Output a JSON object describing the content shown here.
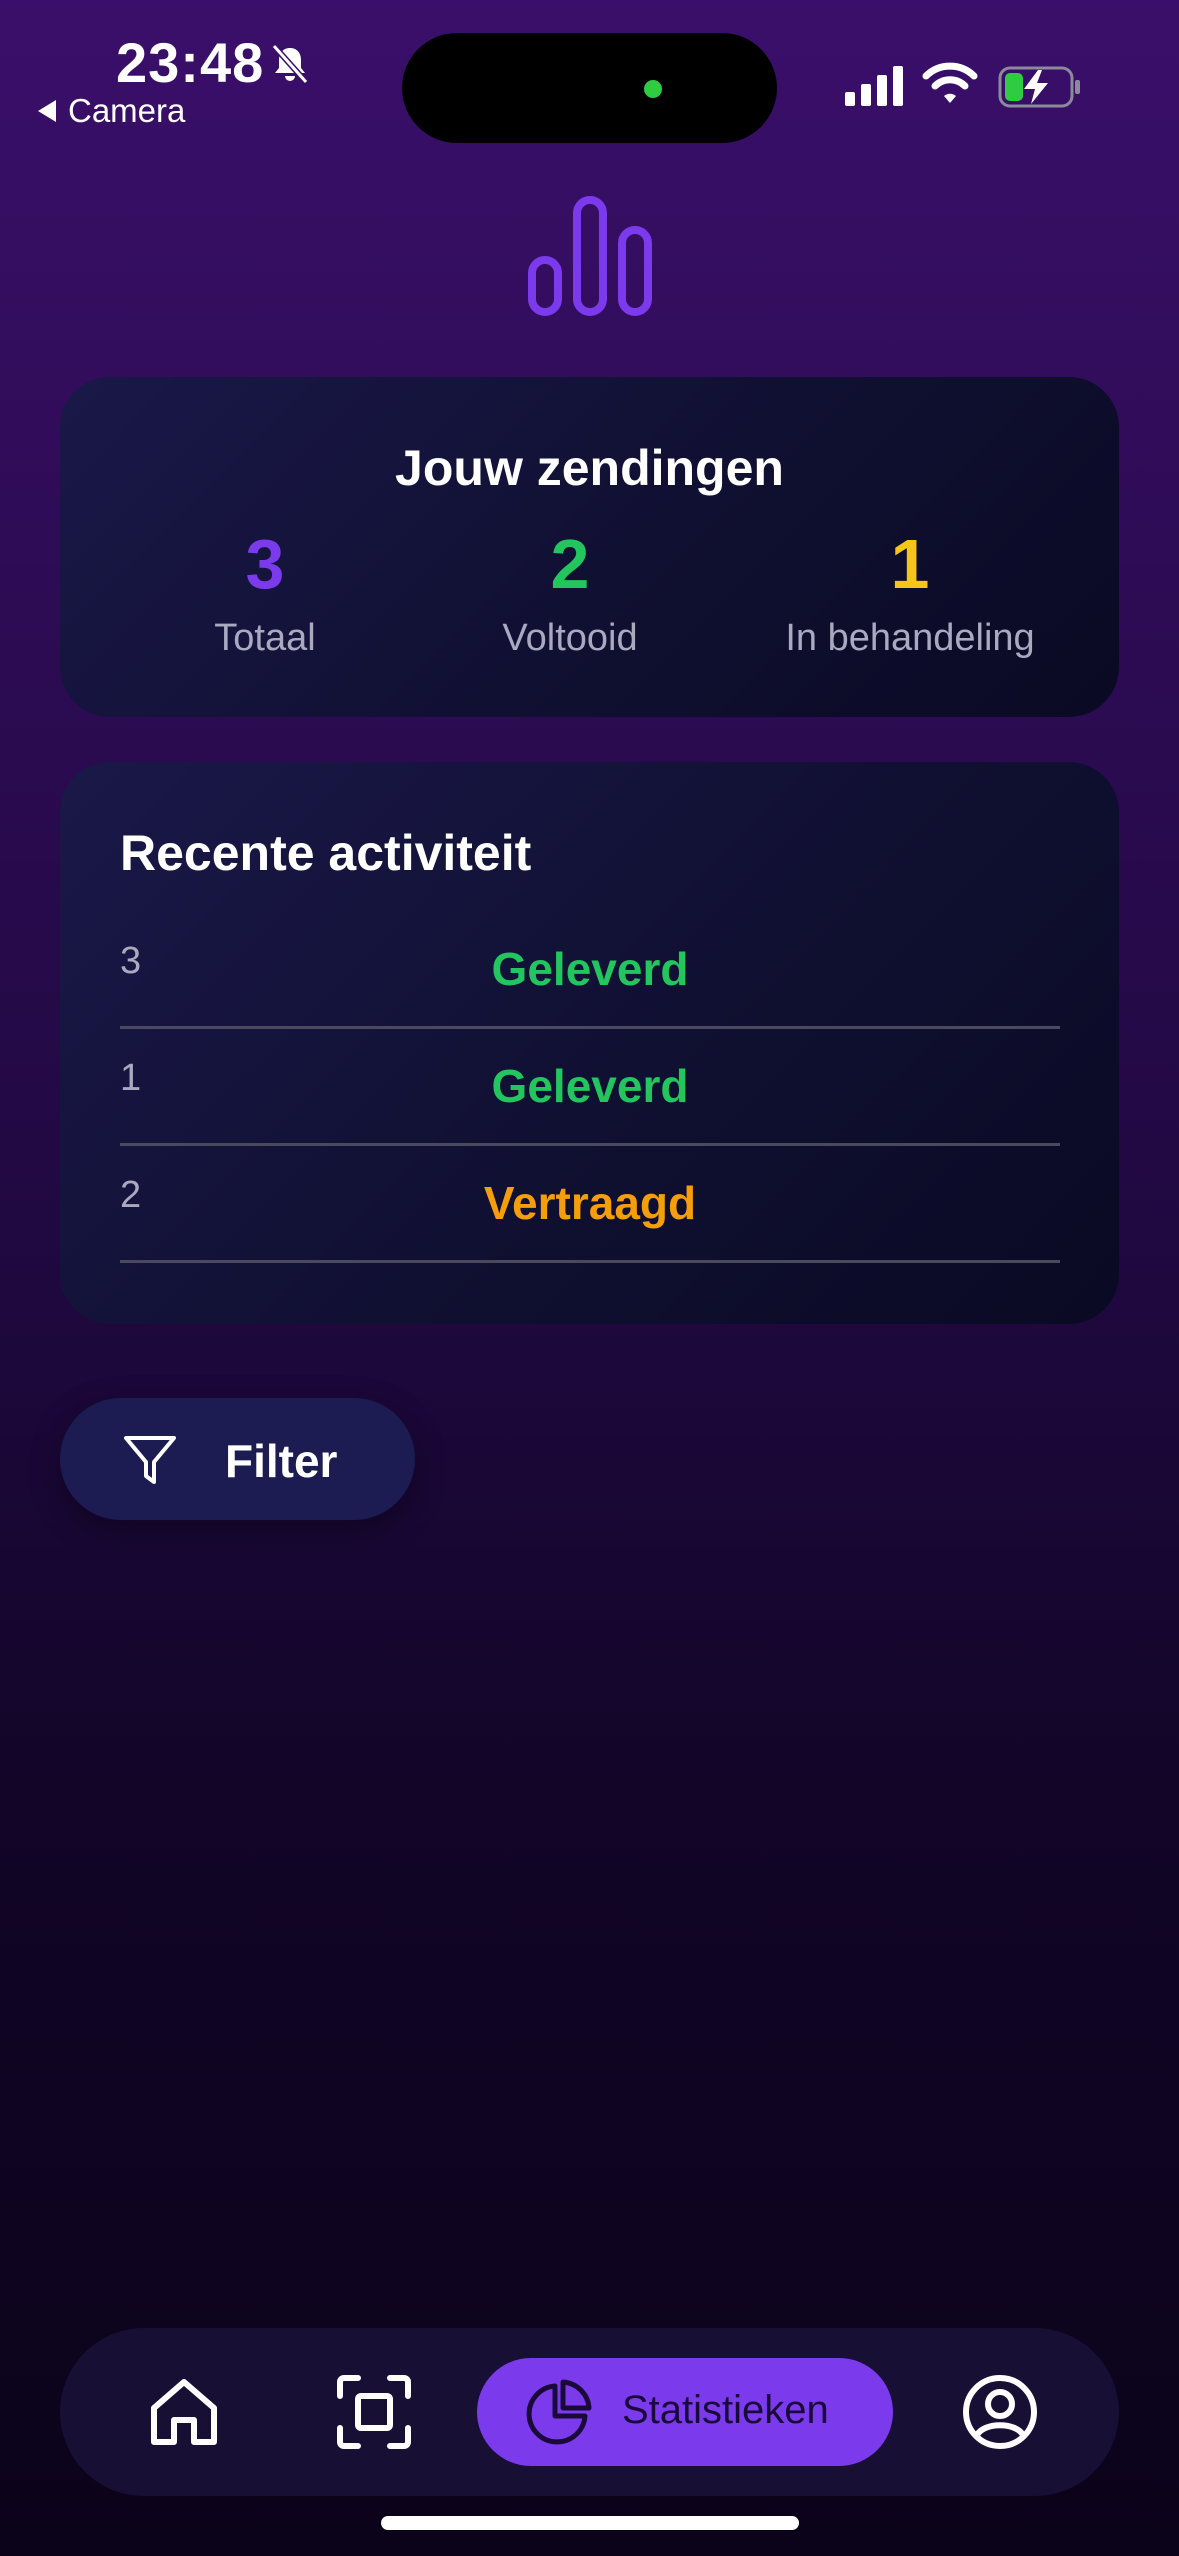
{
  "status_bar": {
    "time": "23:48",
    "back_label": "Camera",
    "icons": [
      "bell-slash-icon",
      "signal-icon",
      "wifi-icon",
      "battery-charging-icon"
    ]
  },
  "header": {
    "logo_icon": "bar-chart-icon"
  },
  "summary": {
    "title": "Jouw zendingen",
    "stats": [
      {
        "value": "3",
        "label": "Totaal",
        "color": "#7c3aed"
      },
      {
        "value": "2",
        "label": "Voltooid",
        "color": "#22c55e"
      },
      {
        "value": "1",
        "label": "In behandeling",
        "color": "#f5c518"
      }
    ]
  },
  "activity": {
    "title": "Recente activiteit",
    "rows": [
      {
        "id": "3",
        "status": "Geleverd",
        "color": "#22c55e"
      },
      {
        "id": "1",
        "status": "Geleverd",
        "color": "#22c55e"
      },
      {
        "id": "2",
        "status": "Vertraagd",
        "color": "#f59e0b"
      }
    ]
  },
  "filter": {
    "label": "Filter",
    "icon": "filter-icon"
  },
  "bottom_nav": {
    "items": [
      {
        "icon": "home-icon",
        "label": ""
      },
      {
        "icon": "scan-icon",
        "label": ""
      },
      {
        "icon": "pie-chart-icon",
        "label": "Statistieken",
        "active": true
      },
      {
        "icon": "profile-icon",
        "label": ""
      }
    ],
    "accent": "#7c3aed"
  }
}
